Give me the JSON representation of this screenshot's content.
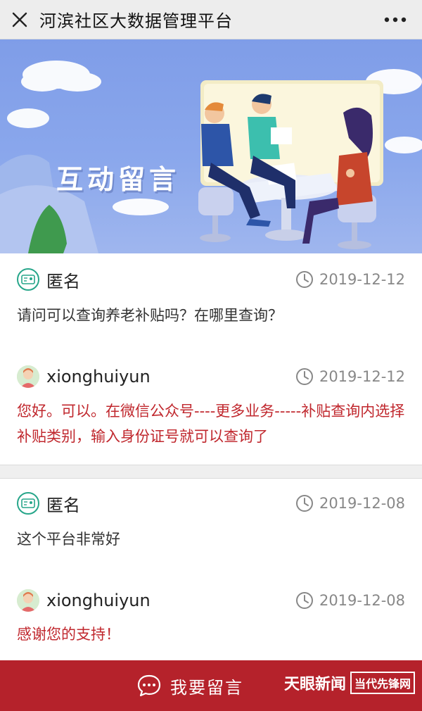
{
  "header": {
    "title": "河滨社区大数据管理平台",
    "close_icon": "close-icon",
    "more_icon": "more-icon"
  },
  "banner": {
    "title": "互动留言"
  },
  "messages": [
    {
      "question": {
        "author": "匿名",
        "date": "2019-12-12",
        "text": "请问可以查询养老补贴吗？在哪里查询？"
      },
      "reply": {
        "author": "xionghuiyun",
        "date": "2019-12-12",
        "text": "您好。可以。在微信公众号----更多业务-----补贴查询内选择补贴类别，输入身份证号就可以查询了"
      }
    },
    {
      "question": {
        "author": "匿名",
        "date": "2019-12-08",
        "text": "这个平台非常好"
      },
      "reply": {
        "author": "xionghuiyun",
        "date": "2019-12-08",
        "text": "感谢您的支持！"
      }
    }
  ],
  "footer": {
    "button_label": "我要留言",
    "button_icon": "chat-icon",
    "watermark_text": "天眼新闻",
    "watermark_text_2": "当代先锋网"
  },
  "colors": {
    "reply_text": "#c0272d",
    "footer_bg": "#b5222b",
    "banner_bg": "#8aa7ec",
    "anon_icon": "#27a68a"
  }
}
